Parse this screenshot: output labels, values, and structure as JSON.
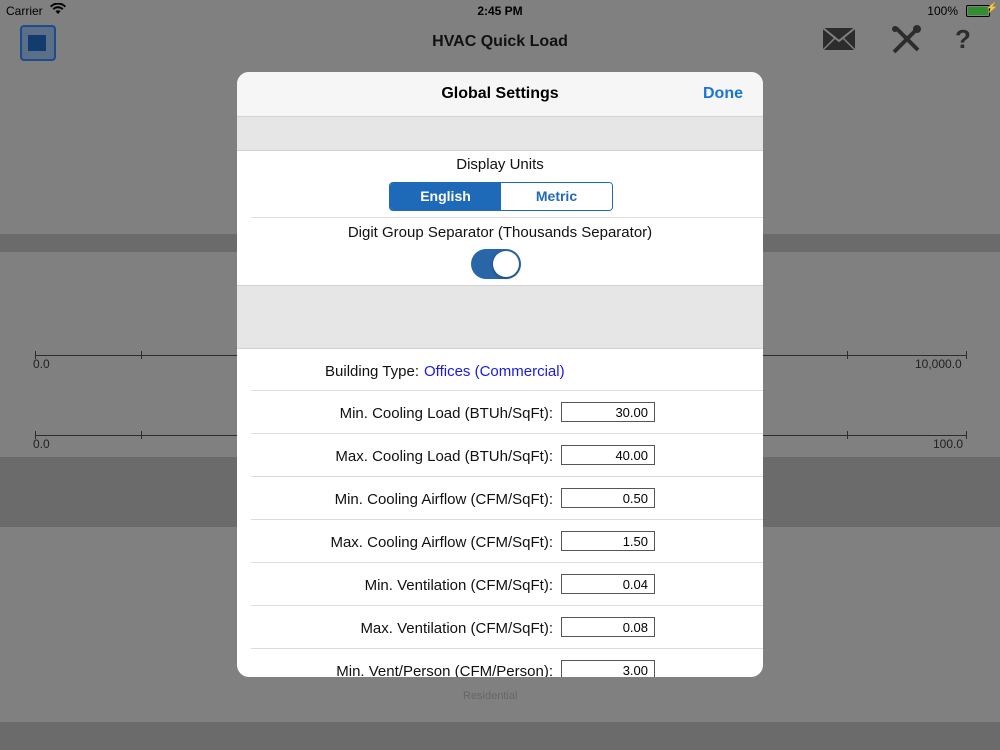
{
  "status_bar": {
    "carrier": "Carrier",
    "time": "2:45 PM",
    "battery": "100%"
  },
  "nav": {
    "title": "HVAC Quick Load",
    "icons": [
      "app-logo-icon",
      "mail-icon",
      "tools-icon",
      "help-icon"
    ],
    "help_glyph": "?"
  },
  "background": {
    "axis1": {
      "min": "0.0",
      "max": "10,000.0"
    },
    "axis2": {
      "min": "0.0",
      "max": "100.0"
    },
    "obscured_text": "Residential"
  },
  "modal": {
    "title": "Global Settings",
    "done_label": "Done",
    "display_units_label": "Display Units",
    "units_options": [
      "English",
      "Metric"
    ],
    "units_selected": "English",
    "separator_label": "Digit Group Separator (Thousands Separator)",
    "separator_enabled": true,
    "building_type_label": "Building Type:",
    "building_type_value": "Offices (Commercial)",
    "rows": [
      {
        "label": "Min. Cooling Load (BTUh/SqFt):",
        "value": "30.00"
      },
      {
        "label": "Max. Cooling Load (BTUh/SqFt):",
        "value": "40.00"
      },
      {
        "label": "Min. Cooling Airflow (CFM/SqFt):",
        "value": "0.50"
      },
      {
        "label": "Max. Cooling Airflow (CFM/SqFt):",
        "value": "1.50"
      },
      {
        "label": "Min. Ventilation (CFM/SqFt):",
        "value": "0.04"
      },
      {
        "label": "Max. Ventilation (CFM/SqFt):",
        "value": "0.08"
      },
      {
        "label": "Min. Vent/Person (CFM/Person):",
        "value": "3.00"
      }
    ]
  },
  "colors": {
    "accent": "#1a73d9",
    "segment_blue": "#1f6ab8",
    "link_blue": "#1a1adf",
    "toggle_on": "#2866a8"
  }
}
